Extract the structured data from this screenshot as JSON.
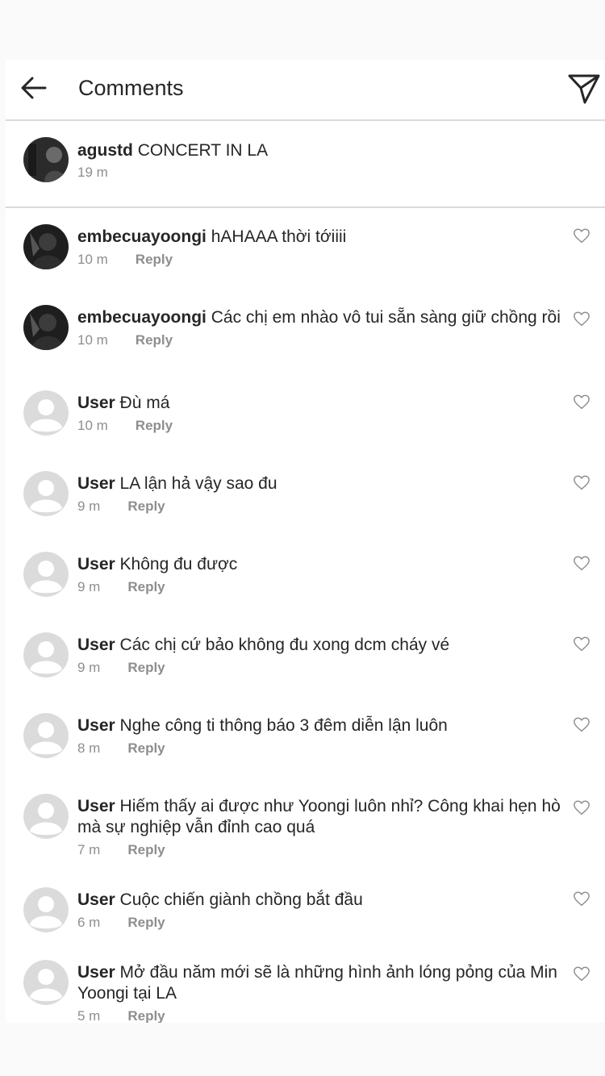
{
  "header": {
    "title": "Comments"
  },
  "caption": {
    "username": "agustd",
    "text": "CONCERT IN LA",
    "time": "19 m"
  },
  "reply_label": "Reply",
  "colors": {
    "text": "#262626",
    "muted": "#8e8e8e",
    "divider": "#dbdbdb",
    "background": "#fafafa"
  },
  "comments": [
    {
      "username": "embecuayoongi",
      "text": "hAHAAA thời tớiiii",
      "time": "10 m",
      "avatar": "dark-photo"
    },
    {
      "username": "embecuayoongi",
      "text": "Các chị em nhào vô tui sẵn sàng giữ chồng rồi",
      "time": "10 m",
      "avatar": "dark-photo"
    },
    {
      "username": "User",
      "text": "Đù má",
      "time": "10 m",
      "avatar": "default"
    },
    {
      "username": "User",
      "text": "LA lận hả vậy sao đu",
      "time": "9 m",
      "avatar": "default"
    },
    {
      "username": "User",
      "text": "Không đu được",
      "time": "9 m",
      "avatar": "default"
    },
    {
      "username": "User",
      "text": "Các chị cứ bảo không đu xong dcm cháy vé",
      "time": "9 m",
      "avatar": "default"
    },
    {
      "username": "User",
      "text": "Nghe công ti thông báo 3 đêm diễn lận luôn",
      "time": "8 m",
      "avatar": "default"
    },
    {
      "username": "User",
      "text": "Hiếm thấy ai được như Yoongi luôn nhỉ? Công khai hẹn hò mà sự nghiệp vẫn đỉnh cao quá",
      "time": "7 m",
      "avatar": "default"
    },
    {
      "username": "User",
      "text": "Cuộc chiến giành chồng bắt đầu",
      "time": "6 m",
      "avatar": "default"
    },
    {
      "username": "User",
      "text": "Mở đầu năm mới sẽ là những hình ảnh lóng pỏng của Min Yoongi tại LA",
      "time": "5 m",
      "avatar": "default"
    }
  ]
}
